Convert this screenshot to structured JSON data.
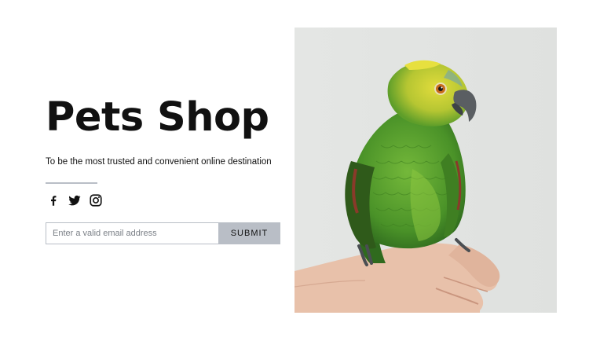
{
  "hero": {
    "title": "Pets Shop",
    "subtitle": "To be the most trusted and convenient online destination"
  },
  "social": [
    {
      "name": "facebook-icon"
    },
    {
      "name": "twitter-icon"
    },
    {
      "name": "instagram-icon"
    }
  ],
  "form": {
    "email_placeholder": "Enter a valid email address",
    "email_value": "",
    "submit_label": "SUBMIT"
  },
  "colors": {
    "text": "#111111",
    "button_bg": "#b9bec6",
    "input_border": "#b9bec6",
    "image_bg": "#e6e8e6",
    "parrot_green": "#4e9a2c",
    "parrot_yellow": "#d8d63a"
  },
  "image": {
    "subject": "parrot-on-hand"
  }
}
